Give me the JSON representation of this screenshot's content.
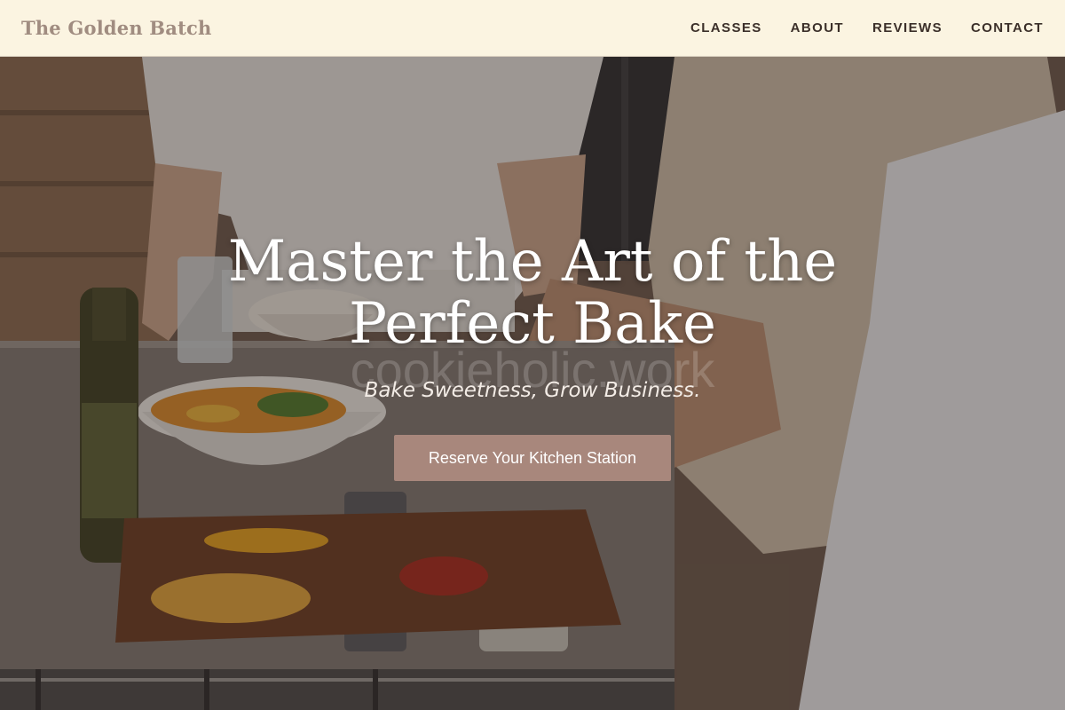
{
  "header": {
    "brand": "The Golden Batch",
    "nav": [
      {
        "label": "CLASSES"
      },
      {
        "label": "ABOUT"
      },
      {
        "label": "REVIEWS"
      },
      {
        "label": "CONTACT"
      }
    ]
  },
  "hero": {
    "headline": "Master the Art of the Perfect Bake",
    "watermark": "cookieholic.work",
    "tagline": "Bake Sweetness, Grow Business.",
    "cta_label": "Reserve Your Kitchen Station"
  },
  "colors": {
    "header_bg": "#fbf4e1",
    "brand": "#a08c80",
    "nav_text": "#3b2f29",
    "cta_bg": "#a8877c"
  }
}
